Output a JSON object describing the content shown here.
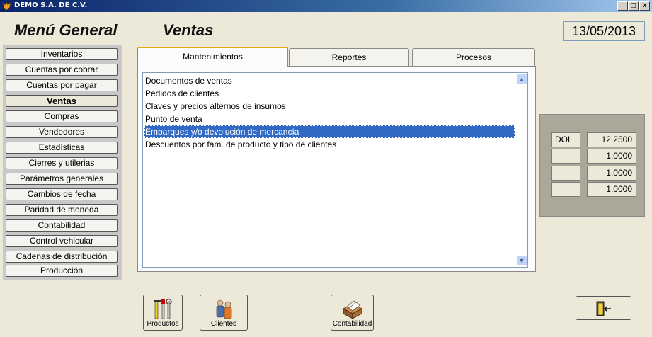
{
  "window": {
    "title": "DEMO S.A. DE C.V.",
    "min": "_",
    "max": "□",
    "close": "x"
  },
  "header": {
    "menu_title": "Menú General",
    "section_title": "Ventas",
    "date": "13/05/2013"
  },
  "sidebar": {
    "items": [
      {
        "label": "Inventarios"
      },
      {
        "label": "Cuentas por cobrar"
      },
      {
        "label": "Cuentas por pagar"
      },
      {
        "label": "Ventas",
        "active": true
      },
      {
        "label": "Compras"
      },
      {
        "label": "Vendedores"
      },
      {
        "label": "Estadísticas"
      },
      {
        "label": "Cierres y utilerias"
      },
      {
        "label": "Parámetros generales"
      },
      {
        "label": "Cambios de fecha"
      },
      {
        "label": "Paridad de moneda"
      },
      {
        "label": "Contabilidad"
      },
      {
        "label": "Control vehicular"
      },
      {
        "label": "Cadenas de distribución"
      },
      {
        "label": "Producción"
      }
    ]
  },
  "tabs": [
    {
      "label": "Mantenimientos",
      "active": true
    },
    {
      "label": "Reportes"
    },
    {
      "label": "Procesos"
    }
  ],
  "list": {
    "items": [
      {
        "label": "Documentos de ventas"
      },
      {
        "label": "Pedidos de clientes"
      },
      {
        "label": "Claves y precios alternos de insumos"
      },
      {
        "label": "Punto de venta"
      },
      {
        "label": "Embarques y/o devolución de mercancía",
        "selected": true
      },
      {
        "label": "Descuentos por fam. de producto y tipo de clientes"
      }
    ],
    "scroll_up": "▲",
    "scroll_down": "▼"
  },
  "rates": [
    {
      "currency": "DOL",
      "value": "12.2500"
    },
    {
      "currency": "",
      "value": "1.0000"
    },
    {
      "currency": "",
      "value": "1.0000"
    },
    {
      "currency": "",
      "value": "1.0000"
    }
  ],
  "shortcuts": [
    {
      "label": "Productos",
      "icon": "tools-icon"
    },
    {
      "label": "Clientes",
      "icon": "people-icon"
    },
    {
      "label": "Contabilidad",
      "icon": "card-box-icon"
    }
  ],
  "exit": {
    "icon": "exit-door-icon"
  },
  "colors": {
    "title_bar": "#0a246a",
    "selection": "#316ac5",
    "active_tab_accent": "#e8a317",
    "sidebar_bg": "#c8c8c8"
  }
}
